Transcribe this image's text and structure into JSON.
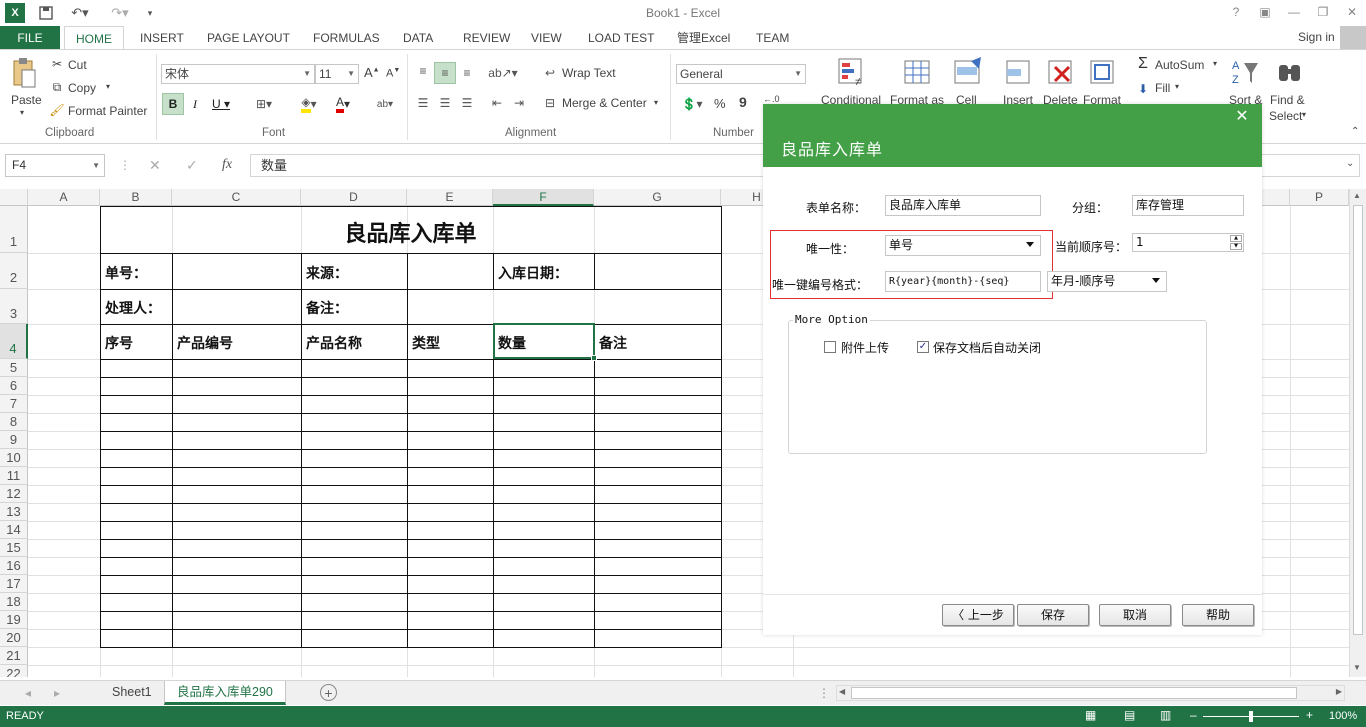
{
  "window": {
    "title": "Book1 - Excel",
    "help": "?",
    "signin": "Sign in"
  },
  "tabs": [
    {
      "label": "FILE"
    },
    {
      "label": "HOME"
    },
    {
      "label": "INSERT"
    },
    {
      "label": "PAGE LAYOUT"
    },
    {
      "label": "FORMULAS"
    },
    {
      "label": "DATA"
    },
    {
      "label": "REVIEW"
    },
    {
      "label": "VIEW"
    },
    {
      "label": "LOAD TEST"
    },
    {
      "label": "管理Excel"
    },
    {
      "label": "TEAM"
    }
  ],
  "ribbon": {
    "clipboard": {
      "paste": "Paste",
      "cut": "Cut",
      "copy": "Copy",
      "format_painter": "Format Painter",
      "label": "Clipboard"
    },
    "font": {
      "name": "宋体",
      "size": "11",
      "label": "Font"
    },
    "alignment": {
      "wrap": "Wrap Text",
      "merge": "Merge & Center",
      "label": "Alignment"
    },
    "number": {
      "format": "General",
      "label": "Number",
      "pct": "%",
      "comma": "9"
    },
    "styles": {
      "conditional": "Conditional",
      "format_as": "Format as",
      "cell": "Cell"
    },
    "cells": {
      "insert": "Insert",
      "delete": "Delete",
      "format": "Format"
    },
    "editing": {
      "autosum": "AutoSum",
      "fill": "Fill",
      "sort": "Sort &",
      "find": "Find &",
      "select": "Select"
    }
  },
  "formula_bar": {
    "name_box": "F4",
    "fx": "fx",
    "value": "数量"
  },
  "grid": {
    "columns": [
      "A",
      "B",
      "C",
      "D",
      "E",
      "F",
      "G",
      "H",
      "P"
    ],
    "rows": [
      "1",
      "2",
      "3",
      "4",
      "5",
      "6",
      "7",
      "8",
      "9",
      "10",
      "11",
      "12",
      "13",
      "14",
      "15",
      "16",
      "17",
      "18",
      "19",
      "20",
      "21",
      "22"
    ],
    "title": "良品库入库单",
    "r2": {
      "b": "单号：",
      "d": "来源：",
      "f": "入库日期："
    },
    "r3": {
      "b": "处理人：",
      "d": "备注："
    },
    "r4": {
      "b": "序号",
      "c": "产品编号",
      "d": "产品名称",
      "e": "类型",
      "f": "数量",
      "g": "备注"
    }
  },
  "sheets": [
    {
      "label": "Sheet1"
    },
    {
      "label": "良品库入库单290"
    }
  ],
  "status": {
    "ready": "READY",
    "zoom": "100%"
  },
  "dialog": {
    "title": "良品库入库单",
    "form_name_label": "表单名称：",
    "form_name": "良品库入库单",
    "group_label": "分组：",
    "group": "库存管理",
    "unique_label": "唯一性：",
    "unique_value": "单号",
    "seq_label": "当前顺序号：",
    "seq_value": "1",
    "key_format_label": "唯一键编号格式：",
    "key_format": "R{year}{month}-{seq}",
    "key_format_option": "年月-顺序号",
    "more_option": "More Option",
    "attach_label": "附件上传",
    "attach_checked": false,
    "autoclose_label": "保存文档后自动关闭",
    "autoclose_checked": true,
    "buttons": {
      "prev": "上一步",
      "save": "保存",
      "cancel": "取消",
      "help": "帮助"
    }
  }
}
